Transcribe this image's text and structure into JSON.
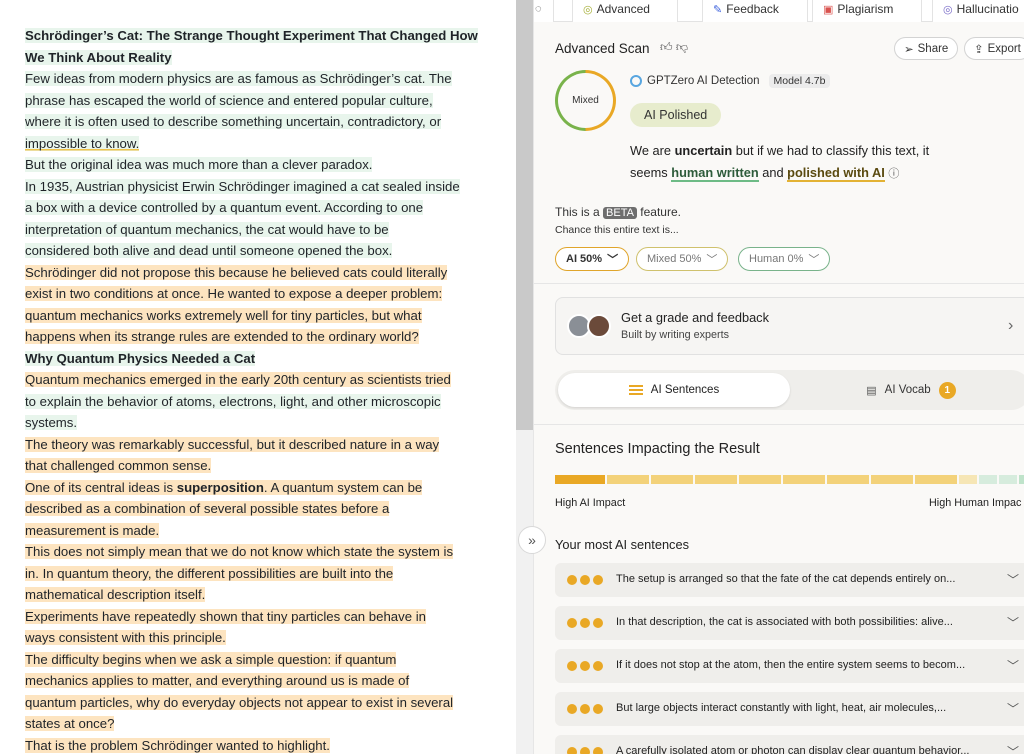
{
  "document": {
    "title_line1": "Schrödinger’s Cat: The Strange Thought Experiment That Changed How",
    "title_line2": "We Think About Reality",
    "p1": [
      "Few ideas from modern physics are as famous as Schrödinger’s cat. The",
      "phrase has escaped the world of science and entered popular culture,",
      "where it is often used to describe something uncertain, contradictory, or",
      "impossible to know."
    ],
    "p2": "But the original idea was much more than a clever paradox.",
    "p3": [
      "In 1935, Austrian physicist Erwin Schrödinger imagined a cat sealed inside",
      "a box with a device controlled by a quantum event. According to one",
      "interpretation of quantum mechanics, the cat would have to be",
      "considered both alive and dead until someone opened the box."
    ],
    "p4_a": "Schrödinger did not propose this because he believed cats could literally",
    "p4_b1": "exist in two conditions at once.",
    "p4_b2": " He wanted to expose a deeper problem:",
    "p4_c": "quantum mechanics works extremely well for tiny particles, but what",
    "p4_d": "happens when its strange rules are extended to the ordinary world?",
    "h2": "Why Quantum Physics Needed a Cat",
    "p5": [
      "Quantum mechanics emerged in the early 20th century as scientists tried",
      "to explain the behavior of atoms, electrons, light, and other microscopic",
      "systems."
    ],
    "p6": [
      "The theory was remarkably successful, but it described nature in a way",
      "that challenged common sense."
    ],
    "p7_a1": "One of its central ideas is ",
    "p7_a2": "superposition",
    "p7_a3": ".",
    "p7_a4": " A quantum system can be",
    "p7_b": "described as a combination of several possible states before a",
    "p7_c": "measurement is made.",
    "p8": [
      "This does not simply mean that we do not know which state the system is",
      "in. In quantum theory, the different possibilities are built into the",
      "mathematical description itself."
    ],
    "p9": [
      "Experiments have repeatedly shown that tiny particles can behave in",
      "ways consistent with this principle."
    ],
    "p10": [
      "The difficulty begins when we ask a simple question: if quantum",
      "mechanics applies to matter, and everything around us is made of",
      "quantum particles, why do everyday objects not appear to exist in several",
      "states at once?"
    ],
    "p11": "That is the problem Schrödinger wanted to highlight."
  },
  "tabs": [
    {
      "label": "Advanced",
      "icon": "gptzero-icon"
    },
    {
      "label": "Feedback",
      "icon": "pen-icon"
    },
    {
      "label": "Plagiarism",
      "icon": "document-icon"
    },
    {
      "label": "Hallucinatio",
      "icon": "spiral-icon"
    }
  ],
  "panel": {
    "scan_title": "Advanced Scan",
    "share_label": "Share",
    "export_label": "Export",
    "ring_label": "Mixed",
    "detector_name": "GPTZero AI Detection",
    "model_badge": "Model 4.7b",
    "verdict_badge": "AI Polished",
    "verdict_pre": "We are ",
    "verdict_strong": "uncertain",
    "verdict_mid": " but if we had to classify this text, it",
    "verdict_pre2": "seems ",
    "verdict_human": "human written",
    "verdict_and": " and ",
    "verdict_ai": "polished with AI",
    "beta_pre": "This is a ",
    "beta_badge": "BETA",
    "beta_post": " feature.",
    "chance_text": "Chance this entire text is...",
    "scores": {
      "ai": "AI 50%",
      "mixed": "Mixed 50%",
      "human": "Human 0%"
    },
    "grade_title": "Get a grade and feedback",
    "grade_sub": "Built by writing experts",
    "seg_ai": "AI Sentences",
    "seg_vocab": "AI Vocab",
    "vocab_count": "1",
    "impact_title": "Sentences Impacting the Result",
    "label_high_ai": "High AI Impact",
    "label_high_human": "High Human Impac",
    "most_title": "Your most AI sentences",
    "sentences": [
      "The setup is arranged so that the fate of the cat depends entirely on...",
      "In that description, the cat is associated with both possibilities: alive...",
      "If it does not stop at the atom, then the entire system seems to becom...",
      "But large objects interact constantly with light, heat, air molecules,...",
      "A carefully isolated atom or photon can display clear quantum behavior..."
    ]
  },
  "colors": {
    "ai": "#e9a825",
    "human": "#6dbb86",
    "mixed_ring": "#a7b03a"
  }
}
